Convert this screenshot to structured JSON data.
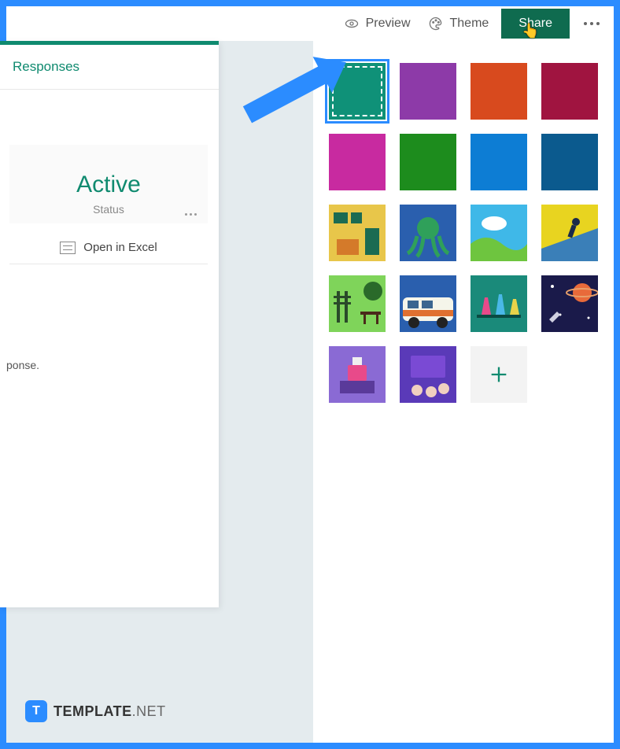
{
  "topbar": {
    "preview": "Preview",
    "theme": "Theme",
    "share": "Share"
  },
  "left": {
    "tab": "Responses",
    "status_value": "Active",
    "status_label": "Status",
    "open_excel": "Open in Excel",
    "fragment_line2": "ponse."
  },
  "themes": {
    "colors": [
      {
        "name": "teal",
        "hex": "#0f9178",
        "selected": true
      },
      {
        "name": "purple",
        "hex": "#8d3aa8",
        "selected": false
      },
      {
        "name": "orange",
        "hex": "#d84a1e",
        "selected": false
      },
      {
        "name": "crimson",
        "hex": "#a01440",
        "selected": false
      },
      {
        "name": "magenta",
        "hex": "#c82aa0",
        "selected": false
      },
      {
        "name": "green",
        "hex": "#1d8c1d",
        "selected": false
      },
      {
        "name": "blue",
        "hex": "#0d7dd4",
        "selected": false
      },
      {
        "name": "navy",
        "hex": "#0b5a8e",
        "selected": false
      }
    ],
    "images": [
      "room",
      "octopus",
      "sky",
      "snowboard",
      "park",
      "van",
      "lab",
      "space",
      "desk",
      "classroom"
    ],
    "add_label": "Add theme"
  },
  "watermark": {
    "badge": "T",
    "brand": "TEMPLATE",
    "suffix": ".NET"
  }
}
